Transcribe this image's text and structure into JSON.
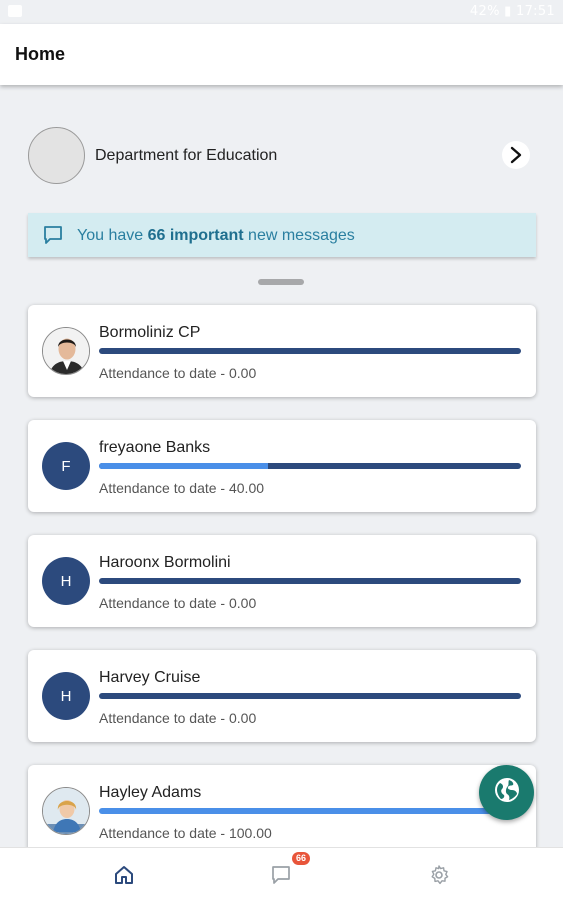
{
  "status_bar": {
    "right_text": "42% ▮ 17:51"
  },
  "app_bar": {
    "title": "Home"
  },
  "organisation": {
    "name": "Department for Education"
  },
  "message_banner": {
    "prefix": "You have ",
    "count_text": "66 important",
    "suffix": " new messages"
  },
  "students": [
    {
      "name": "Bormoliniz CP",
      "avatar": "photo",
      "initial": "",
      "attendance_label": "Attendance to date - 0.00",
      "attendance": 0.0
    },
    {
      "name": "freyaone Banks",
      "avatar": "letter",
      "initial": "F",
      "attendance_label": "Attendance to date - 40.00",
      "attendance": 40.0
    },
    {
      "name": "Haroonx Bormolini",
      "avatar": "letter",
      "initial": "H",
      "attendance_label": "Attendance to date - 0.00",
      "attendance": 0.0
    },
    {
      "name": "Harvey Cruise",
      "avatar": "letter",
      "initial": "H",
      "attendance_label": "Attendance to date - 0.00",
      "attendance": 0.0
    },
    {
      "name": "Hayley Adams",
      "avatar": "photo",
      "initial": "",
      "attendance_label": "Attendance to date - 100.00",
      "attendance": 100.0
    }
  ],
  "bottom_nav": {
    "items": [
      {
        "icon": "home-icon",
        "active": true
      },
      {
        "icon": "messages-icon",
        "active": false
      },
      {
        "icon": "settings-icon",
        "active": false
      }
    ],
    "messages_badge": "66"
  },
  "colors": {
    "primary": "#2c4a7d",
    "progress_fill": "#4a8fe8",
    "banner_bg": "#d4ecf1",
    "banner_text": "#2a7fa0",
    "fab": "#1a7a6e",
    "badge": "#e8553a"
  }
}
